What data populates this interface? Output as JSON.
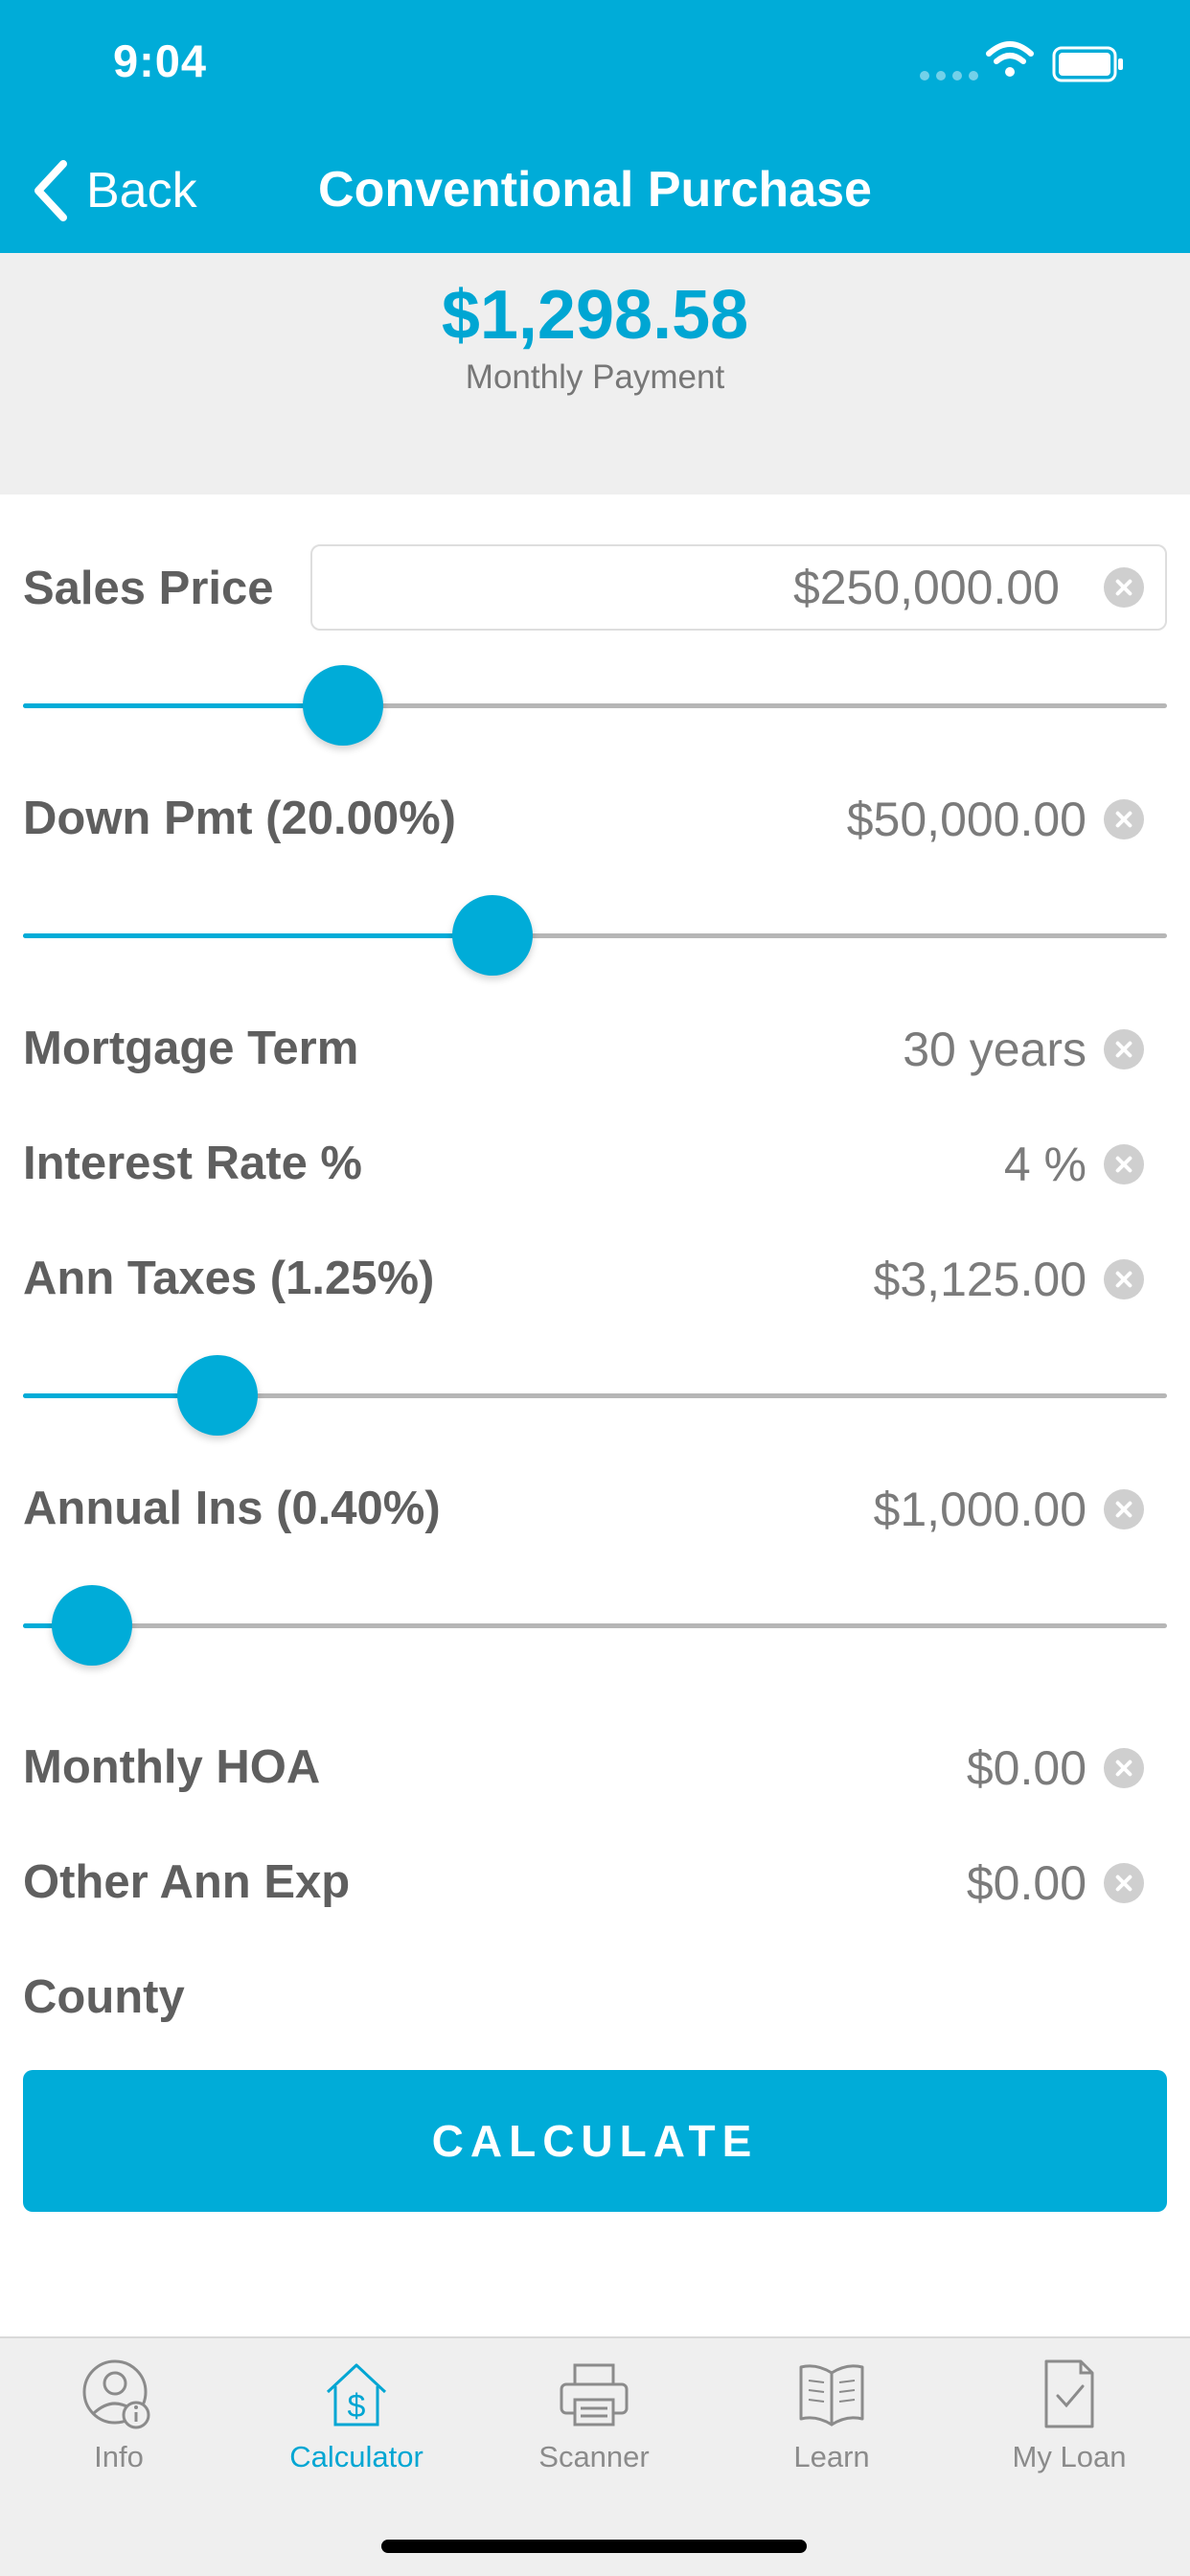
{
  "status_bar": {
    "time": "9:04"
  },
  "nav": {
    "back_label": "Back",
    "title": "Conventional Purchase"
  },
  "summary": {
    "amount": "$1,298.58",
    "label": "Monthly Payment"
  },
  "fields": {
    "sales_price": {
      "label": "Sales Price",
      "value": "$250,000.00",
      "slider_level": 0.28
    },
    "down_pmt": {
      "label": "Down Pmt (20.00%)",
      "value": "$50,000.00",
      "slider_level": 0.41
    },
    "mortgage_term": {
      "label": "Mortgage Term",
      "value": "30 years"
    },
    "interest_rate": {
      "label": "Interest Rate %",
      "value": "4 %"
    },
    "ann_taxes": {
      "label": "Ann Taxes (1.25%)",
      "value": "$3,125.00",
      "slider_level": 0.17
    },
    "annual_ins": {
      "label": "Annual Ins (0.40%)",
      "value": "$1,000.00",
      "slider_level": 0.06
    },
    "monthly_hoa": {
      "label": "Monthly HOA",
      "value": "$0.00"
    },
    "other_ann_exp": {
      "label": "Other Ann Exp",
      "value": "$0.00"
    },
    "county": {
      "label": "County"
    }
  },
  "calculate_label": "CALCULATE",
  "tabs": [
    {
      "label": "Info",
      "icon": "person-info-icon",
      "active": false
    },
    {
      "label": "Calculator",
      "icon": "house-dollar-icon",
      "active": true
    },
    {
      "label": "Scanner",
      "icon": "printer-icon",
      "active": false
    },
    {
      "label": "Learn",
      "icon": "open-book-icon",
      "active": false
    },
    {
      "label": "My Loan",
      "icon": "document-check-icon",
      "active": false
    }
  ],
  "colors": {
    "accent": "#00acd8",
    "text": "#5f5f5f",
    "value_text": "#7b7b7b",
    "panel": "#efefef"
  }
}
